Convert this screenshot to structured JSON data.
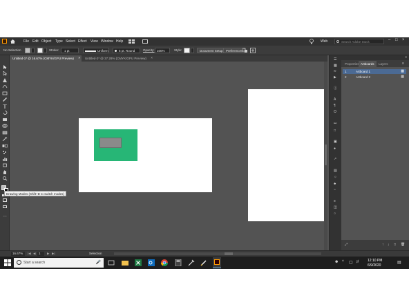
{
  "menubar": {
    "items": [
      "File",
      "Edit",
      "Object",
      "Type",
      "Select",
      "Effect",
      "View",
      "Window",
      "Help"
    ],
    "workspace": "Web",
    "search_placeholder": "Search Adobe Stock"
  },
  "control_bar": {
    "selection": "No Selection",
    "stroke_label": "Stroke:",
    "stroke_value": "1 pt",
    "profile_value": "Uniform",
    "brush_value": "5 pt. Round",
    "opacity_label": "Opacity:",
    "opacity_value": "100%",
    "style_label": "Style:",
    "document_setup": "Document Setup",
    "preferences": "Preferences"
  },
  "tabs": [
    {
      "label": "Untitled-1* @ 16.67% (CMYK/GPU Preview)"
    },
    {
      "label": "Untitled-2* @ 37.28% (CMYK/GPU Preview)"
    }
  ],
  "tooltip": "Drawing Modes (Shift+D to switch modes)",
  "panel": {
    "tabs": [
      "Properties",
      "Artboards",
      "Layers"
    ],
    "artboards": [
      {
        "index": "1",
        "name": "Artboard 1"
      },
      {
        "index": "2",
        "name": "Artboard 2"
      }
    ]
  },
  "statusbar": {
    "zoom": "16.67%",
    "artboard_nav": "1",
    "tool": "Selection"
  },
  "taskbar": {
    "search_placeholder": "Start a search",
    "time": "12:10 PM",
    "date": "6/9/2020"
  },
  "colors": {
    "green_rect": "#27b676",
    "gray_rect": "#8a8a8a",
    "app_badge": "#ff9a00"
  }
}
